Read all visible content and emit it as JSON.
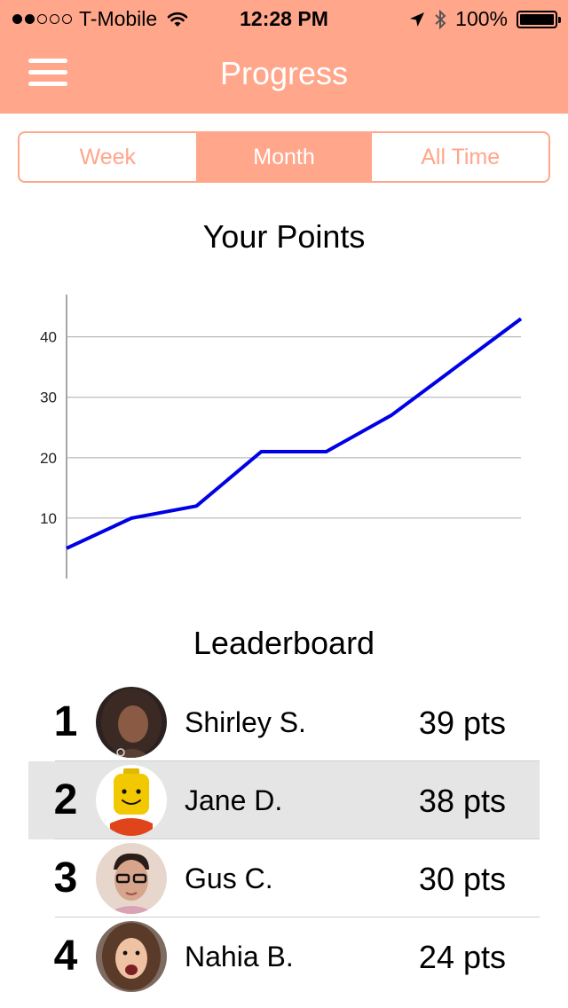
{
  "status_bar": {
    "carrier": "T-Mobile",
    "time": "12:28 PM",
    "battery": "100%"
  },
  "header": {
    "title": "Progress"
  },
  "tabs": [
    {
      "label": "Week",
      "active": false
    },
    {
      "label": "Month",
      "active": true
    },
    {
      "label": "All Time",
      "active": false
    }
  ],
  "chart_title": "Your Points",
  "chart_data": {
    "type": "line",
    "title": "Your Points",
    "xlabel": "",
    "ylabel": "",
    "x": [
      0,
      1,
      2,
      3,
      4,
      5,
      6,
      7
    ],
    "series": [
      {
        "values": [
          5,
          10,
          12,
          21,
          21,
          27,
          35,
          43
        ]
      }
    ],
    "y_ticks": [
      "10",
      "20",
      "30",
      "40"
    ],
    "ylim": [
      0,
      47
    ],
    "grid": true,
    "color": "#0000e6"
  },
  "leaderboard": {
    "title": "Leaderboard",
    "rows": [
      {
        "rank": "1",
        "name": "Shirley S.",
        "points": "39 pts",
        "highlight": false
      },
      {
        "rank": "2",
        "name": "Jane D.",
        "points": "38 pts",
        "highlight": true
      },
      {
        "rank": "3",
        "name": "Gus C.",
        "points": "30 pts",
        "highlight": false
      },
      {
        "rank": "4",
        "name": "Nahia B.",
        "points": "24 pts",
        "highlight": false
      }
    ]
  },
  "colors": {
    "accent": "#ffa68b",
    "highlight_row": "#e5e5e5",
    "line": "#0000e6"
  }
}
